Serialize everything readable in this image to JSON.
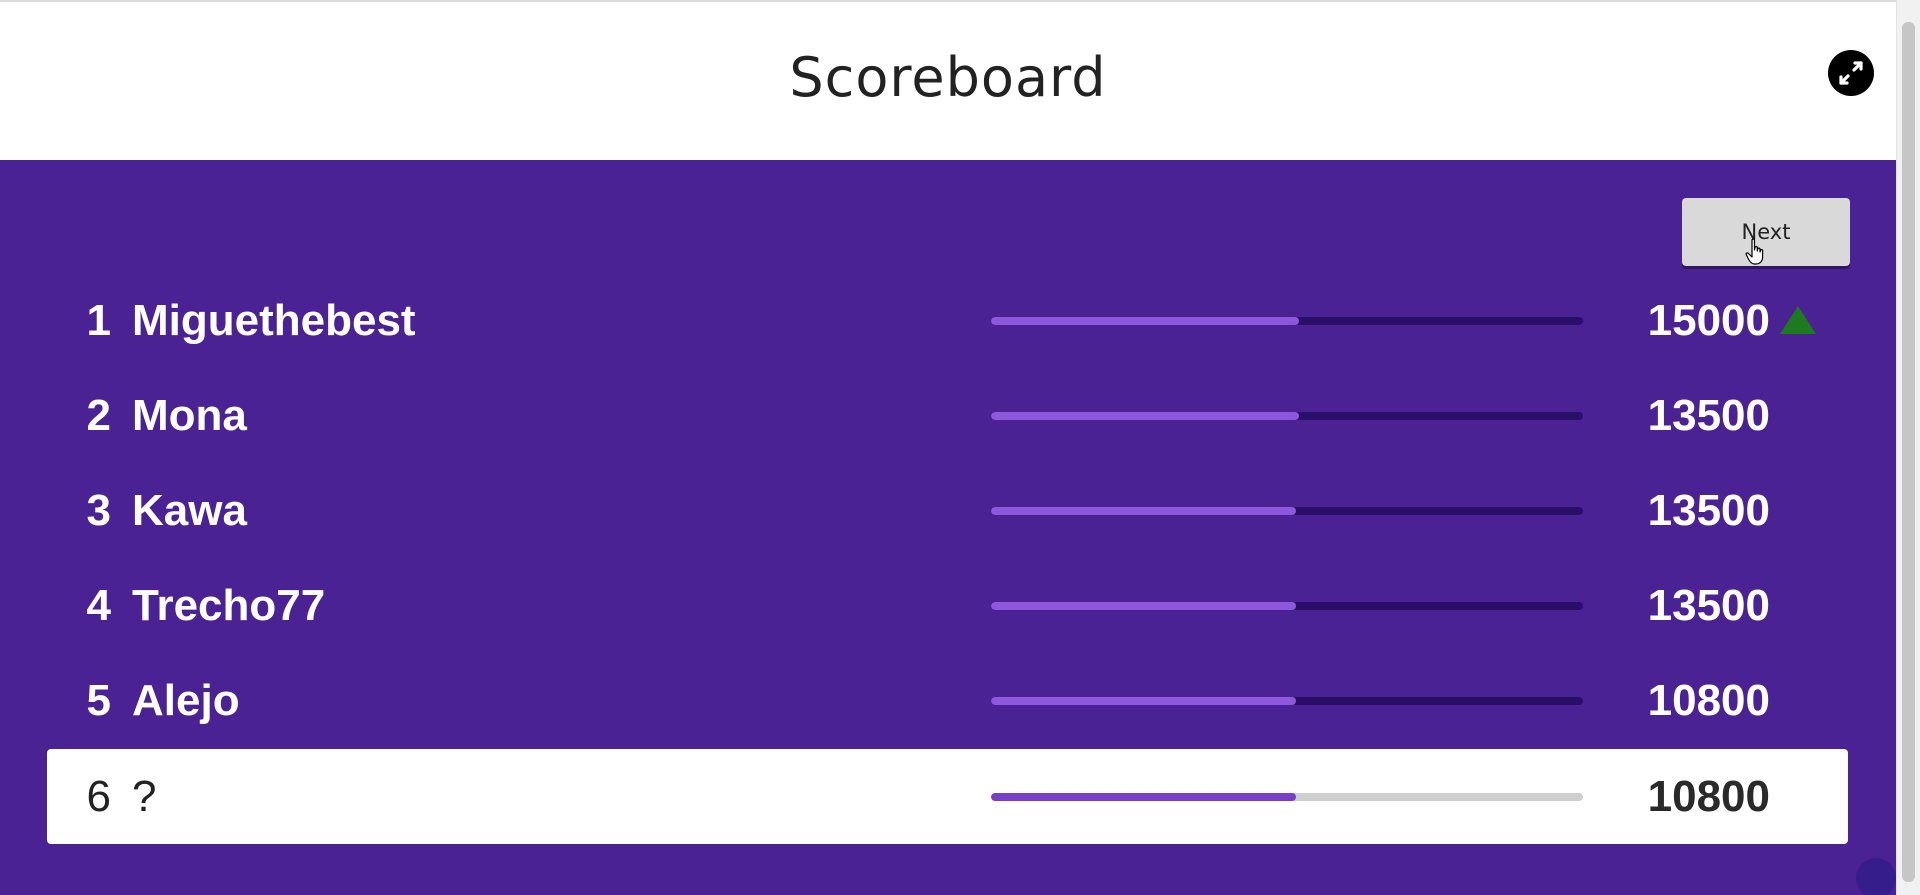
{
  "header": {
    "title": "Scoreboard",
    "fullscreen_icon": "expand-arrows-icon"
  },
  "toolbar": {
    "next_label": "Next"
  },
  "colors": {
    "board_bg": "#4a2293",
    "bar_fill": "#8e58dc",
    "bar_track": "#2a0f68",
    "rank_up": "#1e7a1e",
    "highlight_row_bg": "#ffffff"
  },
  "leaderboard": [
    {
      "rank": "1",
      "name": "Miguethebest",
      "score": "15000",
      "progress": 0.52,
      "trend": "up"
    },
    {
      "rank": "2",
      "name": "Mona",
      "score": "13500",
      "progress": 0.52,
      "trend": ""
    },
    {
      "rank": "3",
      "name": "Kawa",
      "score": "13500",
      "progress": 0.515,
      "trend": ""
    },
    {
      "rank": "4",
      "name": "Trecho77",
      "score": "13500",
      "progress": 0.515,
      "trend": ""
    },
    {
      "rank": "5",
      "name": "Alejo",
      "score": "10800",
      "progress": 0.515,
      "trend": ""
    },
    {
      "rank": "6",
      "name": "?",
      "score": "10800",
      "progress": 0.515,
      "trend": "",
      "highlighted": true
    }
  ]
}
